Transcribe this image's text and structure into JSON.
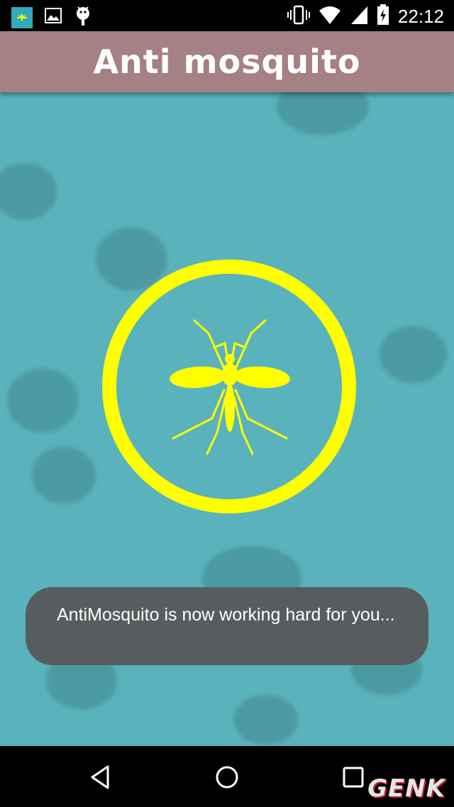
{
  "status_bar": {
    "time": "22:12",
    "left_icons": [
      "app-notification-icon",
      "image-icon",
      "android-debug-icon"
    ],
    "right_icons": [
      "vibrate-icon",
      "wifi-icon",
      "signal-icon",
      "battery-charging-icon"
    ]
  },
  "header": {
    "title": "Anti mosquito"
  },
  "main": {
    "toggle": {
      "icon": "mosquito-icon",
      "ring_color": "#ffff00",
      "state": "on"
    }
  },
  "toast": {
    "message": "AntiMosquito is now working hard for you..."
  },
  "nav": {
    "buttons": [
      "back-icon",
      "home-icon",
      "recents-icon"
    ]
  },
  "watermark": {
    "text": "GENK"
  },
  "colors": {
    "title_bar": "#a58183",
    "background": "#59b2bc",
    "accent": "#ffff00",
    "toast": "#575d5e"
  }
}
